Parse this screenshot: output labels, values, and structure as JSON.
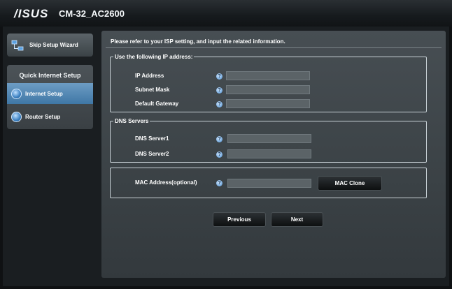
{
  "header": {
    "brand": "/ISUS",
    "model": "CM-32_AC2600"
  },
  "sidebar": {
    "skip_label": "Skip Setup Wizard",
    "menu_title": "Quick Internet Setup",
    "items": [
      {
        "label": "Internet Setup",
        "active": true
      },
      {
        "label": "Router Setup",
        "active": false
      }
    ]
  },
  "main": {
    "intro": "Please refer to your ISP setting, and input the related information.",
    "ip_section": {
      "legend": "Use the following IP address:",
      "fields": [
        {
          "label": "IP Address",
          "value": ""
        },
        {
          "label": "Subnet Mask",
          "value": ""
        },
        {
          "label": "Default Gateway",
          "value": ""
        }
      ]
    },
    "dns_section": {
      "legend": "DNS Servers",
      "fields": [
        {
          "label": "DNS Server1",
          "value": ""
        },
        {
          "label": "DNS Server2",
          "value": ""
        }
      ]
    },
    "mac_section": {
      "label": "MAC Address(optional)",
      "value": "",
      "clone_label": "MAC Clone"
    },
    "help_glyph": "?",
    "buttons": {
      "previous": "Previous",
      "next": "Next"
    }
  },
  "colors": {
    "accent": "#4f86b6",
    "panel": "#41484c",
    "background": "#1a1e21"
  }
}
